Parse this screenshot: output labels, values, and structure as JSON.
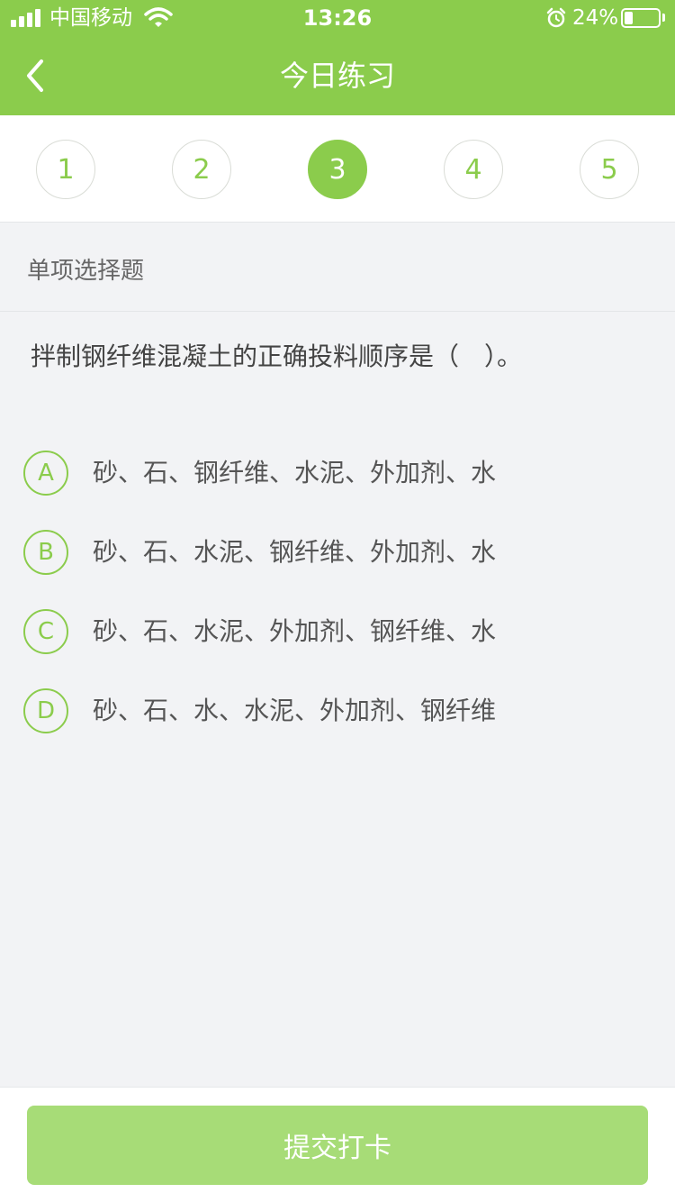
{
  "status_bar": {
    "carrier": "中国移动",
    "time": "13:26",
    "battery_percent": "24%",
    "battery_level": 0.24,
    "icons": [
      "signal-icon",
      "wifi-icon",
      "alarm-icon",
      "battery-icon"
    ]
  },
  "nav": {
    "title": "今日练习",
    "back_icon": "chevron-left-icon"
  },
  "question_numbers": {
    "items": [
      "1",
      "2",
      "3",
      "4",
      "5"
    ],
    "current": "3"
  },
  "question": {
    "type": "单项选择题",
    "text": "拌制钢纤维混凝土的正确投料顺序是（　）。",
    "options": [
      {
        "letter": "A",
        "text": "砂、石、钢纤维、水泥、外加剂、水"
      },
      {
        "letter": "B",
        "text": "砂、石、水泥、钢纤维、外加剂、水"
      },
      {
        "letter": "C",
        "text": "砂、石、水泥、外加剂、钢纤维、水"
      },
      {
        "letter": "D",
        "text": "砂、石、水、水泥、外加剂、钢纤维"
      }
    ]
  },
  "footer": {
    "submit_label": "提交打卡"
  },
  "colors": {
    "accent": "#8bcc4c",
    "submit_disabled": "#a7dc77",
    "background": "#f2f3f5"
  }
}
